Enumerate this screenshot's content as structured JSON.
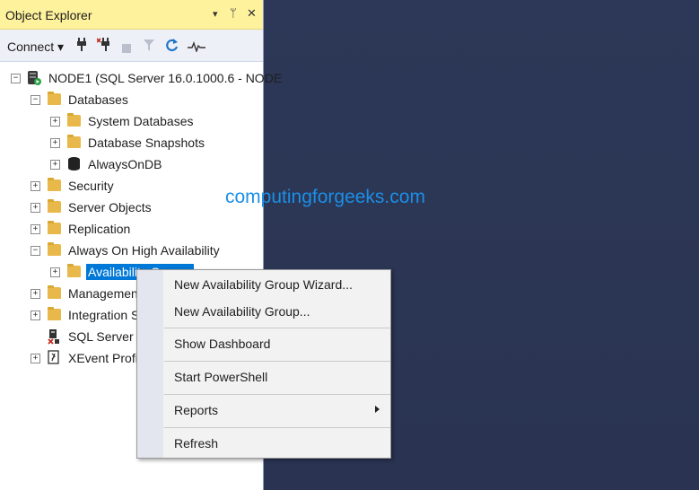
{
  "explorer": {
    "title": "Object Explorer",
    "title_icons": [
      "▾",
      "ᛘ",
      "✕"
    ],
    "toolbar": {
      "connect_label": "Connect ▾"
    },
    "tree": [
      {
        "label": "NODE1 (SQL Server 16.0.1000.6 - NODE",
        "expander": "−",
        "icon": "server-icon"
      },
      {
        "label": "Databases",
        "expander": "−",
        "icon": "folder-icon"
      },
      {
        "label": "System Databases",
        "expander": "+",
        "icon": "folder-icon"
      },
      {
        "label": "Database Snapshots",
        "expander": "+",
        "icon": "folder-icon"
      },
      {
        "label": "AlwaysOnDB",
        "expander": "+",
        "icon": "database-icon"
      },
      {
        "label": "Security",
        "expander": "+",
        "icon": "folder-icon"
      },
      {
        "label": "Server Objects",
        "expander": "+",
        "icon": "folder-icon"
      },
      {
        "label": "Replication",
        "expander": "+",
        "icon": "folder-icon"
      },
      {
        "label": "Always On High Availability",
        "expander": "−",
        "icon": "folder-icon"
      },
      {
        "label": "Availability Groups",
        "expander": "+",
        "icon": "folder-icon"
      },
      {
        "label": "Management",
        "expander": "+",
        "icon": "folder-icon"
      },
      {
        "label": "Integration Services Catalogs",
        "expander": "+",
        "icon": "folder-icon"
      },
      {
        "label": "SQL Server Agent (Agent XPs disabled)",
        "icon": "agent-icon"
      },
      {
        "label": "XEvent Profiler",
        "expander": "+",
        "icon": "xevent-icon"
      }
    ]
  },
  "watermark": "computingforgeeks.com",
  "context_menu": {
    "items": [
      {
        "label": "New Availability Group Wizard..."
      },
      {
        "label": "New Availability Group..."
      },
      {
        "label": "Show Dashboard"
      },
      {
        "label": "Start PowerShell"
      },
      {
        "label": "Reports"
      },
      {
        "label": "Refresh"
      }
    ]
  }
}
